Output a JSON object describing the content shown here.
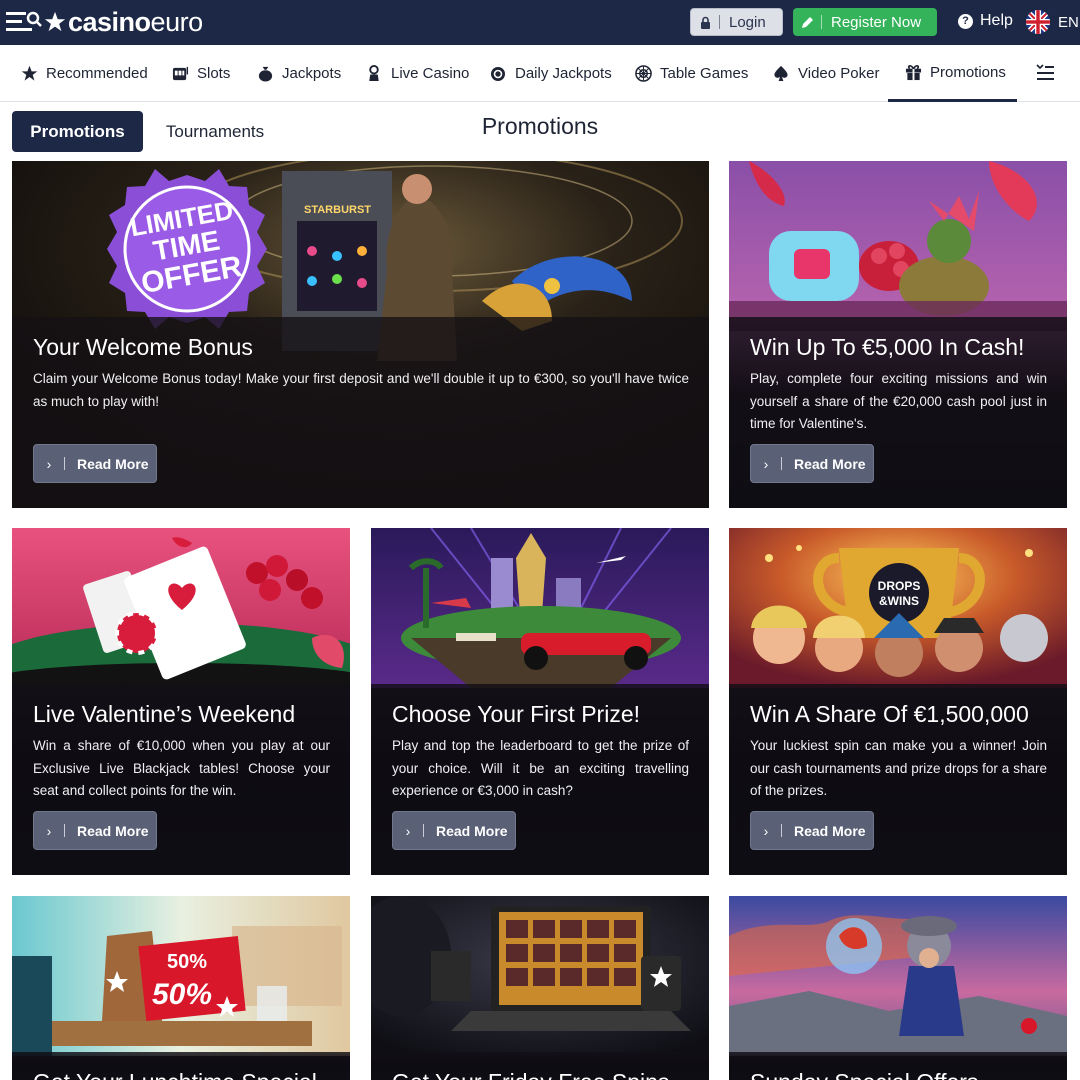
{
  "header": {
    "logo_bold": "casino",
    "logo_light": "euro",
    "login_label": "Login",
    "register_label": "Register Now",
    "help_label": "Help",
    "language": "EN",
    "colors": {
      "bar": "#1c2846",
      "register": "#34b35a"
    }
  },
  "categories": [
    {
      "label": "Recommended",
      "icon": "star-icon"
    },
    {
      "label": "Slots",
      "icon": "slot-machine-icon"
    },
    {
      "label": "Jackpots",
      "icon": "money-bag-icon"
    },
    {
      "label": "Live Casino",
      "icon": "dealer-icon"
    },
    {
      "label": "Daily Jackpots",
      "icon": "coin-icon"
    },
    {
      "label": "Table Games",
      "icon": "roulette-icon"
    },
    {
      "label": "Video Poker",
      "icon": "spade-icon"
    },
    {
      "label": "Promotions",
      "icon": "gift-icon",
      "active": true
    }
  ],
  "tabs": {
    "promotions": "Promotions",
    "tournaments": "Tournaments"
  },
  "page_title": "Promotions",
  "read_more": "Read More",
  "cards": [
    {
      "title": "Your Welcome Bonus",
      "text": "Claim your Welcome Bonus today! Make your first deposit and we'll double it up to €300, so you'll have twice as much to play with!",
      "badge": [
        "LIMITED",
        "TIME",
        "OFFER"
      ],
      "slot_name": "STARBURST"
    },
    {
      "title": "Win Up To €5,000 In Cash!",
      "text": "Play, complete four exciting missions and win yourself a share of the €20,000 cash pool just in time for Valentine's."
    },
    {
      "title": "Live Valentine’s Weekend",
      "text": "Win a share of €10,000 when you play at our Exclusive Live Blackjack tables! Choose your seat and collect points for the win."
    },
    {
      "title": "Choose Your First Prize!",
      "text": "Play and top the leaderboard to get the prize of your choice. Will it be an exciting travelling experience or €3,000 in cash?"
    },
    {
      "title": "Win A Share Of €1,500,000",
      "text": "Your luckiest spin can make you a winner! Join our cash tournaments and prize drops for a share of the prizes.",
      "badge": [
        "DROPS",
        "&WINS"
      ]
    },
    {
      "title": "Get Your Lunchtime Special",
      "badge": [
        "50%",
        "50%"
      ]
    },
    {
      "title": "Get Your Friday Free Spins"
    },
    {
      "title": "Sunday Special Offers"
    }
  ]
}
